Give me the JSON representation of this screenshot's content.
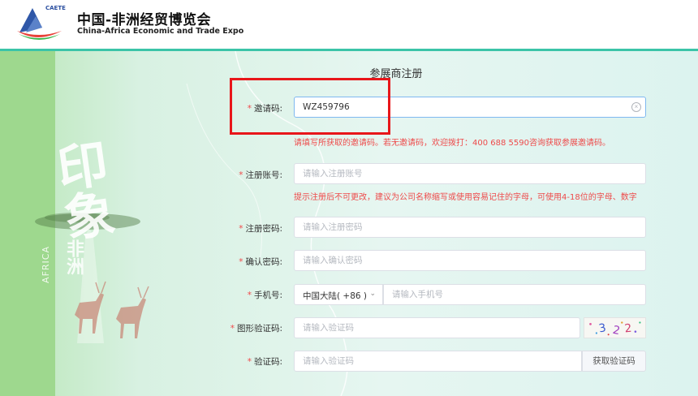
{
  "header": {
    "logo_tag": "CAETE",
    "title_cn": "中国-非洲经贸博览会",
    "title_en": "China-Africa Economic and Trade Expo"
  },
  "decor": {
    "big_text": "印象",
    "africa_cn": "非洲",
    "africa_en": "AFRICA"
  },
  "form": {
    "title": "参展商注册",
    "fields": {
      "invite": {
        "label": "邀请码:",
        "value": "WZ459796",
        "hint": "请填写所获取的邀请码。若无邀请码，欢迎拨打：400 688 5590咨询获取参展邀请码。"
      },
      "account": {
        "label": "注册账号:",
        "placeholder": "请输入注册账号",
        "hint": "提示注册后不可更改，建议为公司名称缩写或使用容易记住的字母，可使用4-18位的字母、数字"
      },
      "password": {
        "label": "注册密码:",
        "placeholder": "请输入注册密码"
      },
      "confirm": {
        "label": "确认密码:",
        "placeholder": "请输入确认密码"
      },
      "phone": {
        "label": "手机号:",
        "region": "中国大陆( +86 )",
        "placeholder": "请输入手机号"
      },
      "captcha": {
        "label": "图形验证码:",
        "placeholder": "请输入验证码",
        "image_text": "3 2 2"
      },
      "sms": {
        "label": "验证码:",
        "placeholder": "请输入验证码",
        "button": "获取验证码"
      }
    }
  }
}
